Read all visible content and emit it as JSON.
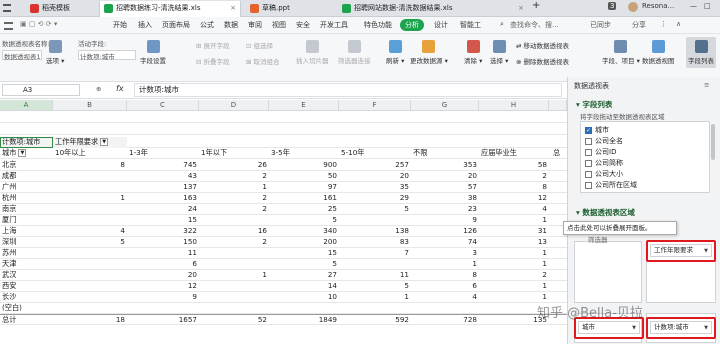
{
  "tabs": [
    {
      "label": "稻壳模板",
      "color": "#d9342b"
    },
    {
      "label": "招聘数据练习-清洗结果.xls",
      "color": "#1ba34e"
    },
    {
      "label": "草稿.ppt",
      "color": "#e5632b"
    },
    {
      "label": "招聘网站数据-清洗数据结果.xls",
      "color": "#1ba34e"
    }
  ],
  "top_right": {
    "count": "3",
    "user": "Resona..."
  },
  "menus": [
    "开始",
    "插入",
    "页面布局",
    "公式",
    "数据",
    "审阅",
    "视图",
    "安全",
    "开发工具",
    "特色功能",
    "分析",
    "设计",
    "智能工"
  ],
  "search_placeholder": "查找命令、搜...",
  "sync_status": "已同步",
  "share_label": "分享",
  "ribbon": {
    "pivot_name_label": "数据透视表名称:",
    "pivot_name_value": "数据透视表1",
    "options": "选项",
    "active_field_label": "活动字段:",
    "active_field_value": "计数项:城市",
    "field_settings": "字段设置",
    "expand_field": "展开字段",
    "collapse_field": "折叠字段",
    "group_selection": "组选择",
    "ungroup": "取消组合",
    "insert_slicer": "插入切片器",
    "filter_connections": "筛选器连接",
    "refresh": "刷新",
    "change_source": "更改数据源",
    "clear": "清除",
    "select": "选择",
    "move_pivot": "移动数据透视表",
    "delete_pivot": "删除数据透视表",
    "fields_items": "字段、项目",
    "pivot_chart": "数据透视图",
    "field_list": "字段列表"
  },
  "name_box": "A3",
  "formula": "计数项:城市",
  "fx": "fx",
  "columns": [
    "A",
    "B",
    "C",
    "D",
    "E",
    "F",
    "G",
    "H"
  ],
  "pivot": {
    "corner": "计数项:城市",
    "col_field": "工作年限要求",
    "row_field": "城市",
    "col_headers": [
      "10年以上",
      "1-3年",
      "1年以下",
      "3-5年",
      "5-10年",
      "不限",
      "应届毕业生"
    ],
    "rows": [
      {
        "city": "北京",
        "v": [
          "8",
          "745",
          "26",
          "900",
          "257",
          "353",
          "58"
        ]
      },
      {
        "city": "成都",
        "v": [
          "",
          "43",
          "2",
          "50",
          "20",
          "20",
          "2"
        ]
      },
      {
        "city": "广州",
        "v": [
          "",
          "137",
          "1",
          "97",
          "35",
          "57",
          "8"
        ]
      },
      {
        "city": "杭州",
        "v": [
          "1",
          "163",
          "2",
          "161",
          "29",
          "38",
          "12"
        ]
      },
      {
        "city": "南京",
        "v": [
          "",
          "24",
          "2",
          "25",
          "5",
          "23",
          "4"
        ]
      },
      {
        "city": "厦门",
        "v": [
          "",
          "15",
          "",
          "5",
          "",
          "9",
          "1"
        ]
      },
      {
        "city": "上海",
        "v": [
          "4",
          "322",
          "16",
          "340",
          "138",
          "126",
          "31"
        ]
      },
      {
        "city": "深圳",
        "v": [
          "5",
          "150",
          "2",
          "200",
          "83",
          "74",
          "13"
        ]
      },
      {
        "city": "苏州",
        "v": [
          "",
          "11",
          "",
          "15",
          "7",
          "3",
          "1"
        ]
      },
      {
        "city": "天津",
        "v": [
          "",
          "6",
          "",
          "5",
          "",
          "1",
          "1"
        ]
      },
      {
        "city": "武汉",
        "v": [
          "",
          "20",
          "1",
          "27",
          "11",
          "8",
          "2"
        ]
      },
      {
        "city": "西安",
        "v": [
          "",
          "12",
          "",
          "14",
          "5",
          "6",
          "1"
        ]
      },
      {
        "city": "长沙",
        "v": [
          "",
          "9",
          "",
          "10",
          "1",
          "4",
          "1"
        ]
      },
      {
        "city": "(空白)",
        "v": [
          "",
          "",
          "",
          "",
          "",
          "",
          ""
        ]
      }
    ],
    "total": {
      "label": "总计",
      "v": [
        "18",
        "1657",
        "52",
        "1849",
        "592",
        "728",
        "135"
      ]
    }
  },
  "pane": {
    "title": "数据透视表",
    "section_fields": "字段列表",
    "drag_hint": "将字段拖动至数据透视表区域",
    "fields": [
      {
        "label": "城市",
        "checked": true
      },
      {
        "label": "公司全名",
        "checked": false
      },
      {
        "label": "公司ID",
        "checked": false
      },
      {
        "label": "公司简称",
        "checked": false
      },
      {
        "label": "公司大小",
        "checked": false
      },
      {
        "label": "公司所在区域",
        "checked": false
      }
    ],
    "section_areas": "数据透视表区域",
    "tooltip": "点击此处可以折叠展开面板。",
    "filter_label": "筛选器",
    "col_chip": "工作年限要求",
    "row_chip": "城市",
    "value_chip": "计数项:城市"
  },
  "watermark": "知乎 @Bella-贝拉"
}
